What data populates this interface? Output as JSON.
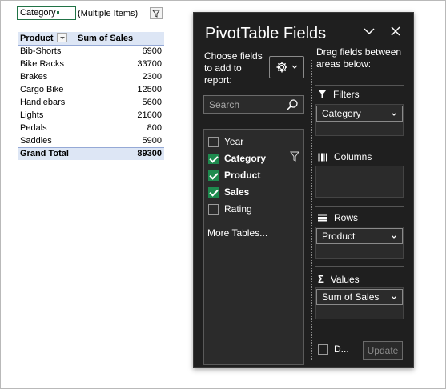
{
  "sheet": {
    "filter": {
      "field": "Category",
      "value": "(Multiple Items)"
    },
    "pivot": {
      "header": {
        "product": "Product",
        "sales": "Sum of Sales"
      },
      "rows": [
        {
          "product": "Bib-Shorts",
          "sales": "6900"
        },
        {
          "product": "Bike Racks",
          "sales": "33700"
        },
        {
          "product": "Brakes",
          "sales": "2300"
        },
        {
          "product": "Cargo Bike",
          "sales": "12500"
        },
        {
          "product": "Handlebars",
          "sales": "5600"
        },
        {
          "product": "Lights",
          "sales": "21600"
        },
        {
          "product": "Pedals",
          "sales": "800"
        },
        {
          "product": "Saddles",
          "sales": "5900"
        }
      ],
      "total": {
        "label": "Grand Total",
        "sales": "89300"
      }
    }
  },
  "pane": {
    "title": "PivotTable Fields",
    "choose_text": "Choose fields to add to report:",
    "search_placeholder": "Search",
    "fields": [
      {
        "label": "Year",
        "checked": false
      },
      {
        "label": "Category",
        "checked": true
      },
      {
        "label": "Product",
        "checked": true
      },
      {
        "label": "Sales",
        "checked": true
      },
      {
        "label": "Rating",
        "checked": false
      }
    ],
    "more_tables": "More Tables...",
    "drag_text": "Drag fields between areas below:",
    "areas": {
      "filters": {
        "title": "Filters",
        "chip": "Category"
      },
      "columns": {
        "title": "Columns"
      },
      "rows": {
        "title": "Rows",
        "chip": "Product"
      },
      "values": {
        "title": "Values",
        "chip": "Sum of Sales"
      }
    },
    "defer_label": "D...",
    "update_label": "Update"
  },
  "colors": {
    "accent": "#217346",
    "checkbox": "#1e8a4e",
    "pane_bg": "#1f1f1f",
    "header_fill": "#dde6f5"
  }
}
